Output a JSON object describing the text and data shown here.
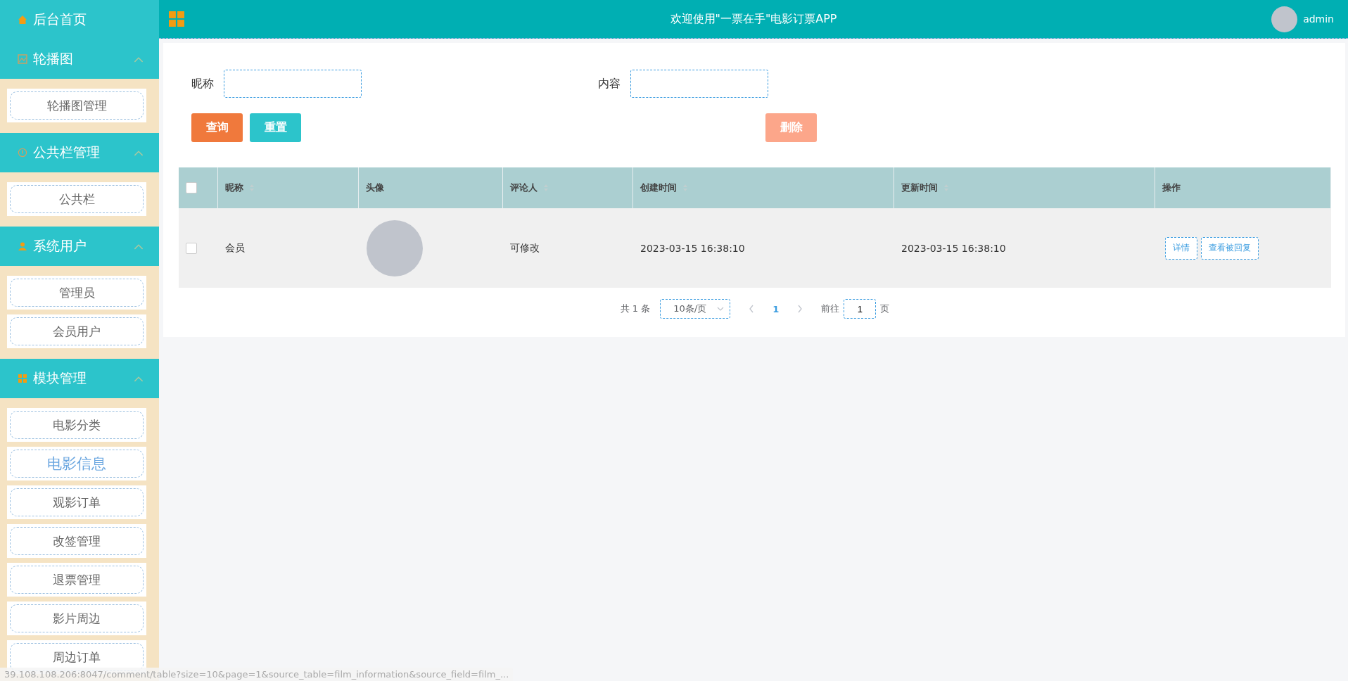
{
  "sidebar": {
    "home": {
      "label": "后台首页"
    },
    "groups": [
      {
        "label": "轮播图",
        "expanded": true,
        "items": [
          {
            "label": "轮播图管理",
            "selected": false
          }
        ]
      },
      {
        "label": "公共栏管理",
        "expanded": true,
        "items": [
          {
            "label": "公共栏",
            "selected": false
          }
        ]
      },
      {
        "label": "系统用户",
        "expanded": true,
        "items": [
          {
            "label": "管理员",
            "selected": false
          },
          {
            "label": "会员用户",
            "selected": false
          }
        ]
      },
      {
        "label": "模块管理",
        "expanded": true,
        "items": [
          {
            "label": "电影分类",
            "selected": false
          },
          {
            "label": "电影信息",
            "selected": true
          },
          {
            "label": "观影订单",
            "selected": false
          },
          {
            "label": "改签管理",
            "selected": false
          },
          {
            "label": "退票管理",
            "selected": false
          },
          {
            "label": "影片周边",
            "selected": false
          },
          {
            "label": "周边订单",
            "selected": false
          }
        ]
      }
    ]
  },
  "header": {
    "title": "欢迎使用\"一票在手\"电影订票APP",
    "user": "admin"
  },
  "filters": [
    {
      "label": "昵称"
    },
    {
      "label": "内容"
    }
  ],
  "buttons": [
    {
      "label": "查询",
      "kind": "search"
    },
    {
      "label": "重置",
      "kind": "reset"
    },
    {
      "label": "删除",
      "kind": "delete"
    }
  ],
  "table": {
    "all_checked": false,
    "columns": [
      {
        "label": "昵称",
        "sortable": true
      },
      {
        "label": "头像",
        "sortable": false
      },
      {
        "label": "评论人",
        "sortable": true
      },
      {
        "label": "创建时间",
        "sortable": true
      },
      {
        "label": "更新时间",
        "sortable": true
      },
      {
        "label": "操作",
        "sortable": false
      }
    ],
    "rows": [
      {
        "checked": false,
        "nickname": "会员",
        "commenter": "可修改",
        "created": "2023-03-15 16:38:10",
        "updated": "2023-03-15 16:38:10",
        "actions": [
          "详情",
          "查看被回复"
        ]
      }
    ]
  },
  "pagination": {
    "total": "共 1 条",
    "page_size": "10条/页",
    "pages": [
      {
        "label": "1",
        "selected": true
      }
    ],
    "goto_label": "前往",
    "goto_value": "1",
    "goto_suffix": "页"
  },
  "status_url": "39.108.108.206:8047/comment/table?size=10&page=1&source_table=film_information&source_field=film_..."
}
